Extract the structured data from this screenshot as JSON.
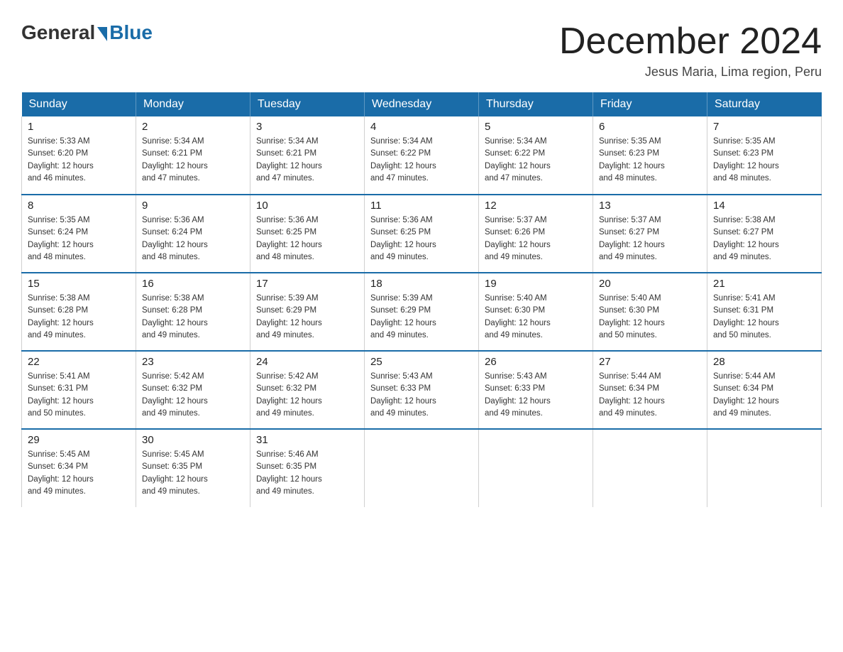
{
  "logo": {
    "general": "General",
    "blue": "Blue"
  },
  "title": "December 2024",
  "subtitle": "Jesus Maria, Lima region, Peru",
  "days_of_week": [
    "Sunday",
    "Monday",
    "Tuesday",
    "Wednesday",
    "Thursday",
    "Friday",
    "Saturday"
  ],
  "weeks": [
    [
      {
        "day": "1",
        "sunrise": "5:33 AM",
        "sunset": "6:20 PM",
        "daylight": "12 hours and 46 minutes."
      },
      {
        "day": "2",
        "sunrise": "5:34 AM",
        "sunset": "6:21 PM",
        "daylight": "12 hours and 47 minutes."
      },
      {
        "day": "3",
        "sunrise": "5:34 AM",
        "sunset": "6:21 PM",
        "daylight": "12 hours and 47 minutes."
      },
      {
        "day": "4",
        "sunrise": "5:34 AM",
        "sunset": "6:22 PM",
        "daylight": "12 hours and 47 minutes."
      },
      {
        "day": "5",
        "sunrise": "5:34 AM",
        "sunset": "6:22 PM",
        "daylight": "12 hours and 47 minutes."
      },
      {
        "day": "6",
        "sunrise": "5:35 AM",
        "sunset": "6:23 PM",
        "daylight": "12 hours and 48 minutes."
      },
      {
        "day": "7",
        "sunrise": "5:35 AM",
        "sunset": "6:23 PM",
        "daylight": "12 hours and 48 minutes."
      }
    ],
    [
      {
        "day": "8",
        "sunrise": "5:35 AM",
        "sunset": "6:24 PM",
        "daylight": "12 hours and 48 minutes."
      },
      {
        "day": "9",
        "sunrise": "5:36 AM",
        "sunset": "6:24 PM",
        "daylight": "12 hours and 48 minutes."
      },
      {
        "day": "10",
        "sunrise": "5:36 AM",
        "sunset": "6:25 PM",
        "daylight": "12 hours and 48 minutes."
      },
      {
        "day": "11",
        "sunrise": "5:36 AM",
        "sunset": "6:25 PM",
        "daylight": "12 hours and 49 minutes."
      },
      {
        "day": "12",
        "sunrise": "5:37 AM",
        "sunset": "6:26 PM",
        "daylight": "12 hours and 49 minutes."
      },
      {
        "day": "13",
        "sunrise": "5:37 AM",
        "sunset": "6:27 PM",
        "daylight": "12 hours and 49 minutes."
      },
      {
        "day": "14",
        "sunrise": "5:38 AM",
        "sunset": "6:27 PM",
        "daylight": "12 hours and 49 minutes."
      }
    ],
    [
      {
        "day": "15",
        "sunrise": "5:38 AM",
        "sunset": "6:28 PM",
        "daylight": "12 hours and 49 minutes."
      },
      {
        "day": "16",
        "sunrise": "5:38 AM",
        "sunset": "6:28 PM",
        "daylight": "12 hours and 49 minutes."
      },
      {
        "day": "17",
        "sunrise": "5:39 AM",
        "sunset": "6:29 PM",
        "daylight": "12 hours and 49 minutes."
      },
      {
        "day": "18",
        "sunrise": "5:39 AM",
        "sunset": "6:29 PM",
        "daylight": "12 hours and 49 minutes."
      },
      {
        "day": "19",
        "sunrise": "5:40 AM",
        "sunset": "6:30 PM",
        "daylight": "12 hours and 49 minutes."
      },
      {
        "day": "20",
        "sunrise": "5:40 AM",
        "sunset": "6:30 PM",
        "daylight": "12 hours and 50 minutes."
      },
      {
        "day": "21",
        "sunrise": "5:41 AM",
        "sunset": "6:31 PM",
        "daylight": "12 hours and 50 minutes."
      }
    ],
    [
      {
        "day": "22",
        "sunrise": "5:41 AM",
        "sunset": "6:31 PM",
        "daylight": "12 hours and 50 minutes."
      },
      {
        "day": "23",
        "sunrise": "5:42 AM",
        "sunset": "6:32 PM",
        "daylight": "12 hours and 49 minutes."
      },
      {
        "day": "24",
        "sunrise": "5:42 AM",
        "sunset": "6:32 PM",
        "daylight": "12 hours and 49 minutes."
      },
      {
        "day": "25",
        "sunrise": "5:43 AM",
        "sunset": "6:33 PM",
        "daylight": "12 hours and 49 minutes."
      },
      {
        "day": "26",
        "sunrise": "5:43 AM",
        "sunset": "6:33 PM",
        "daylight": "12 hours and 49 minutes."
      },
      {
        "day": "27",
        "sunrise": "5:44 AM",
        "sunset": "6:34 PM",
        "daylight": "12 hours and 49 minutes."
      },
      {
        "day": "28",
        "sunrise": "5:44 AM",
        "sunset": "6:34 PM",
        "daylight": "12 hours and 49 minutes."
      }
    ],
    [
      {
        "day": "29",
        "sunrise": "5:45 AM",
        "sunset": "6:34 PM",
        "daylight": "12 hours and 49 minutes."
      },
      {
        "day": "30",
        "sunrise": "5:45 AM",
        "sunset": "6:35 PM",
        "daylight": "12 hours and 49 minutes."
      },
      {
        "day": "31",
        "sunrise": "5:46 AM",
        "sunset": "6:35 PM",
        "daylight": "12 hours and 49 minutes."
      },
      null,
      null,
      null,
      null
    ]
  ],
  "labels": {
    "sunrise": "Sunrise:",
    "sunset": "Sunset:",
    "daylight": "Daylight:"
  }
}
